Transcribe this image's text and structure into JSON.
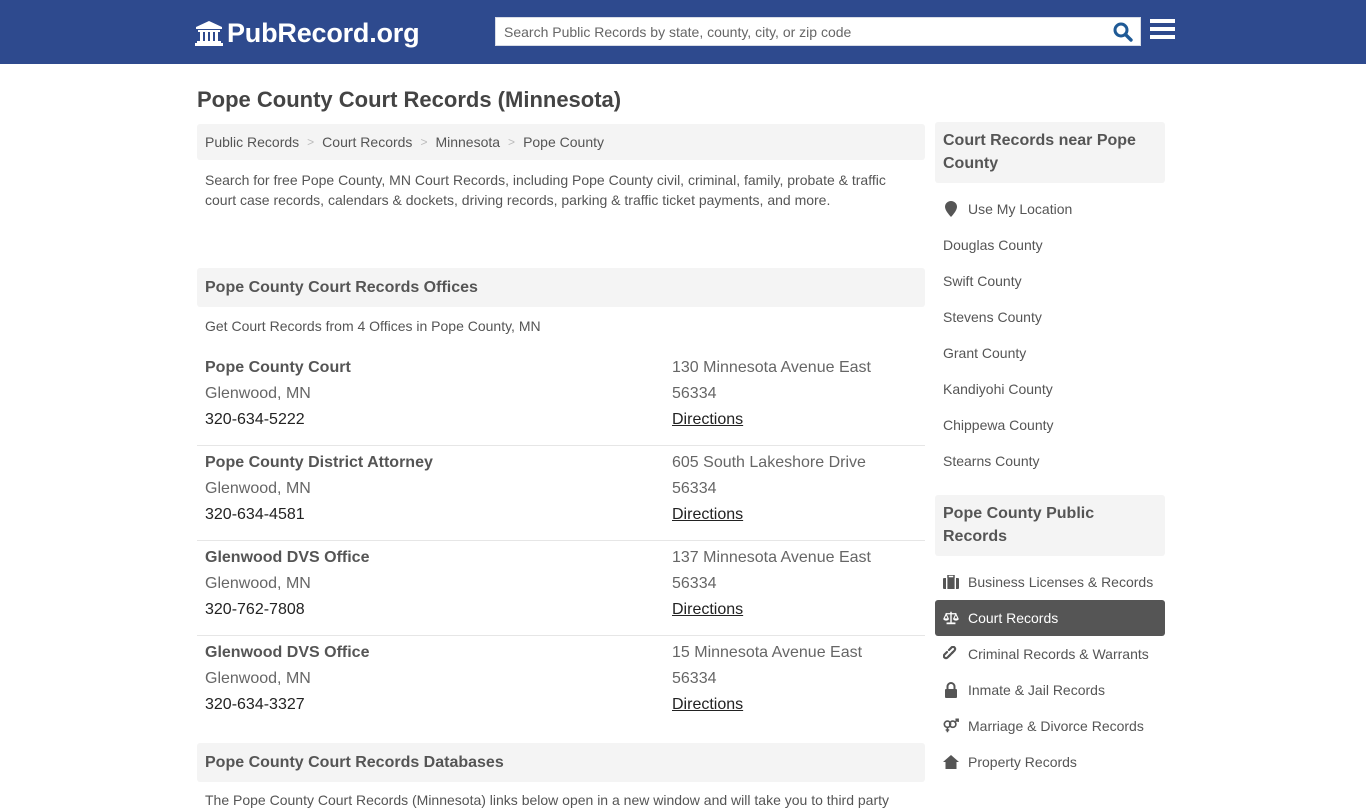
{
  "header": {
    "logo_text": "PubRecord.org",
    "logo_icon": "courthouse-icon",
    "search_placeholder": "Search Public Records by state, county, city, or zip code",
    "search_value": "",
    "colors": {
      "nav_bg": "#2e4a8e",
      "search_icon": "#1f5a96"
    }
  },
  "page": {
    "title": "Pope County Court Records (Minnesota)"
  },
  "breadcrumb": [
    {
      "label": "Public Records"
    },
    {
      "label": "Court Records"
    },
    {
      "label": "Minnesota"
    },
    {
      "label": "Pope County"
    }
  ],
  "intro": "Search for free Pope County, MN Court Records, including Pope County civil, criminal, family, probate & traffic court case records, calendars & dockets, driving records, parking & traffic ticket payments, and more.",
  "offices_section": {
    "heading": "Pope County Court Records Offices",
    "subtitle": "Get Court Records from 4 Offices in Pope County, MN",
    "offices": [
      {
        "name": "Pope County Court",
        "city": "Glenwood, MN",
        "phone": "320-634-5222",
        "address": "130 Minnesota Avenue East",
        "zip": "56334",
        "directions": "Directions"
      },
      {
        "name": "Pope County District Attorney",
        "city": "Glenwood, MN",
        "phone": "320-634-4581",
        "address": "605 South Lakeshore Drive",
        "zip": "56334",
        "directions": "Directions"
      },
      {
        "name": "Glenwood DVS Office",
        "city": "Glenwood, MN",
        "phone": "320-762-7808",
        "address": "137 Minnesota Avenue East",
        "zip": "56334",
        "directions": "Directions"
      },
      {
        "name": "Glenwood DVS Office",
        "city": "Glenwood, MN",
        "phone": "320-634-3327",
        "address": "15 Minnesota Avenue East",
        "zip": "56334",
        "directions": "Directions"
      }
    ]
  },
  "databases_section": {
    "heading": "Pope County Court Records Databases",
    "text": "The Pope County Court Records (Minnesota) links below open in a new window and will take you to third party"
  },
  "sidebar": {
    "nearby": {
      "heading": "Court Records near Pope County",
      "use_location": {
        "label": "Use My Location",
        "icon": "map-marker-icon"
      },
      "counties": [
        "Douglas County",
        "Swift County",
        "Stevens County",
        "Grant County",
        "Kandiyohi County",
        "Chippewa County",
        "Stearns County"
      ]
    },
    "public_records": {
      "heading": "Pope County Public Records",
      "items": [
        {
          "label": "Business Licenses & Records",
          "icon": "briefcase-icon",
          "active": false
        },
        {
          "label": "Court Records",
          "icon": "scales-icon",
          "active": true
        },
        {
          "label": "Criminal Records & Warrants",
          "icon": "link-icon",
          "active": false
        },
        {
          "label": "Inmate & Jail Records",
          "icon": "lock-icon",
          "active": false
        },
        {
          "label": "Marriage & Divorce Records",
          "icon": "gender-icon",
          "active": false
        },
        {
          "label": "Property Records",
          "icon": "home-icon",
          "active": false
        }
      ]
    }
  }
}
